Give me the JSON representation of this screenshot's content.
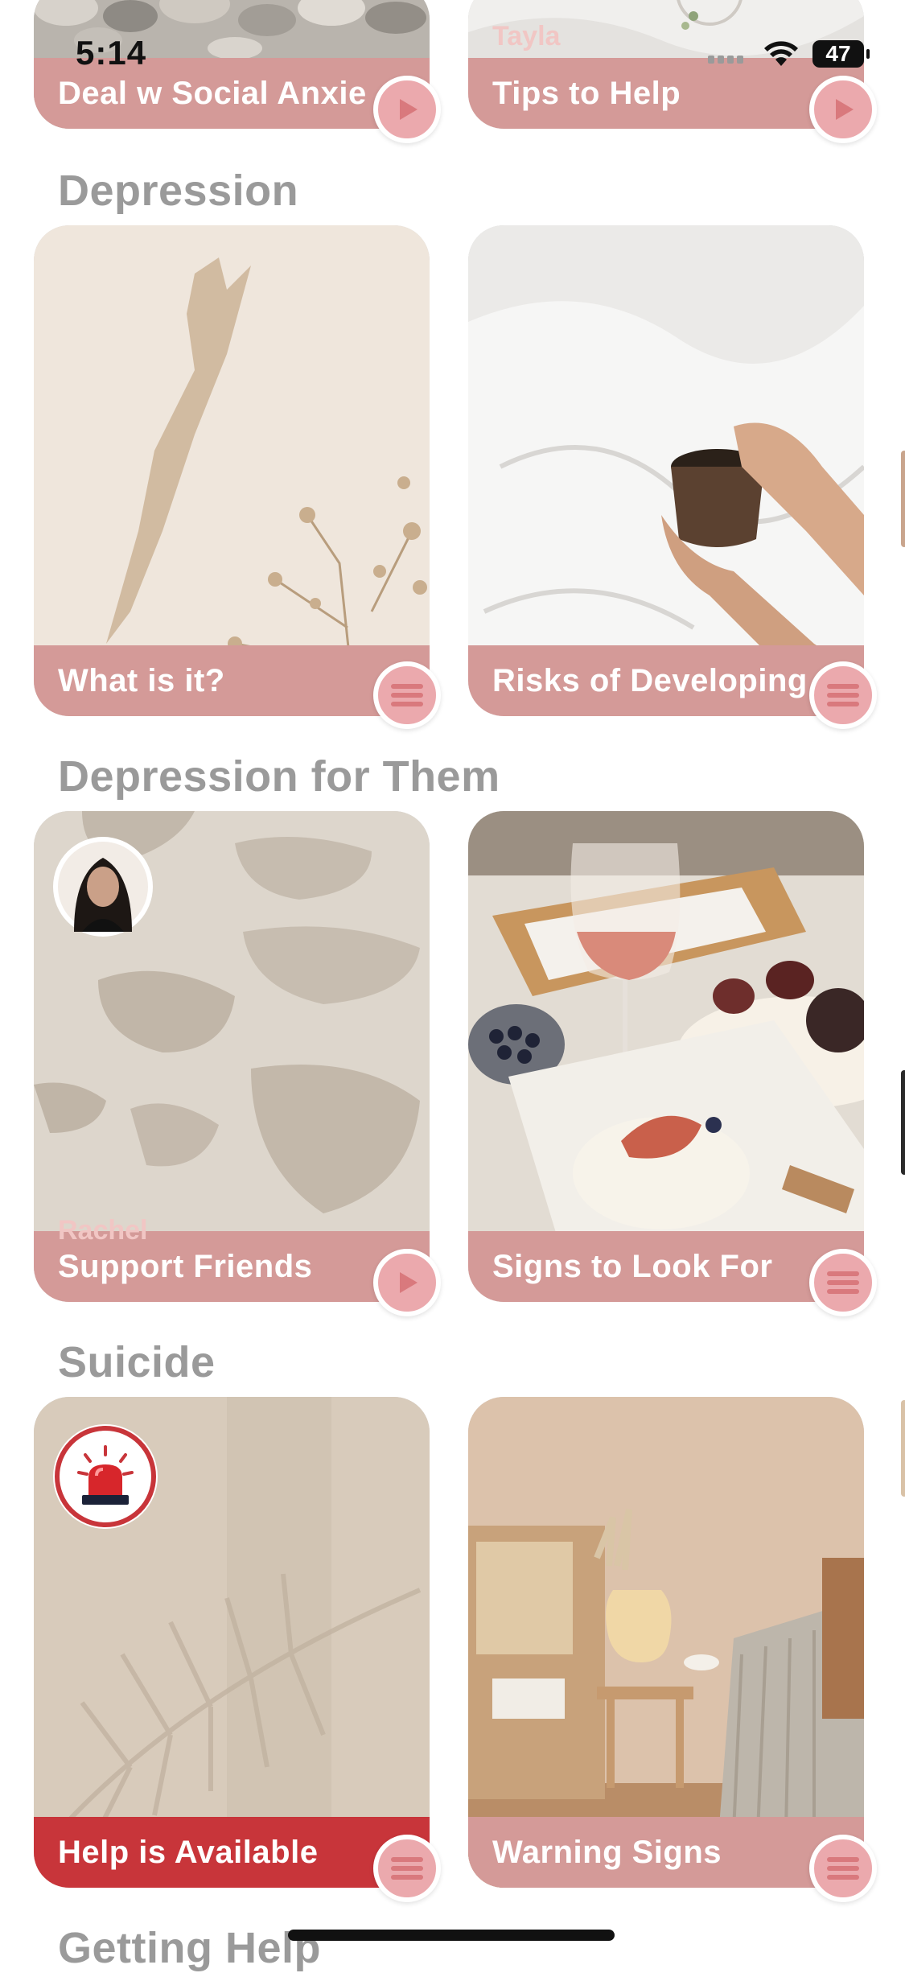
{
  "status_bar": {
    "time": "5:14",
    "battery": "47"
  },
  "colors": {
    "card_bar": "#d49a98",
    "alert_bar": "#c8353a",
    "fab": "#eba9ad",
    "section_title": "#9a9a9a"
  },
  "sections": [
    {
      "title": "",
      "cards": [
        {
          "label": "Deal w Social Anxie",
          "action": "play-icon"
        },
        {
          "label": "Tips to Help",
          "author": "Tayla",
          "action": "play-icon"
        }
      ]
    },
    {
      "title": "Depression",
      "cards": [
        {
          "label": "What is it?",
          "action": "list-icon"
        },
        {
          "label": "Risks of Developing",
          "action": "list-icon"
        }
      ]
    },
    {
      "title": "Depression for Them",
      "cards": [
        {
          "label": "Support Friends",
          "author": "Rachel",
          "action": "play-icon"
        },
        {
          "label": "Signs to Look For",
          "action": "list-icon"
        }
      ]
    },
    {
      "title": "Suicide",
      "cards": [
        {
          "label": "Help is Available",
          "action": "list-icon"
        },
        {
          "label": "Warning Signs",
          "action": "list-icon"
        }
      ]
    },
    {
      "title": "Getting Help",
      "cards": []
    }
  ]
}
